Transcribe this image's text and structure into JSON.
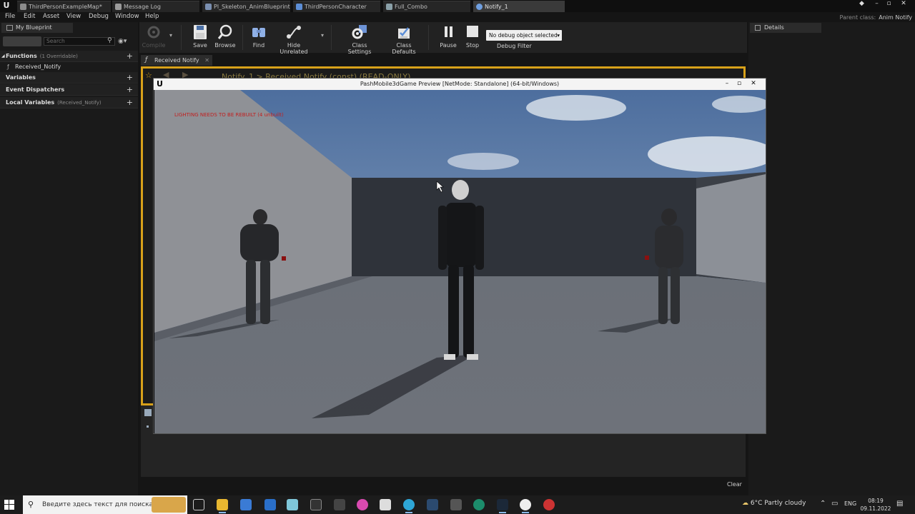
{
  "doc_tabs": [
    {
      "label": "ThirdPersonExampleMap*",
      "active": false
    },
    {
      "label": "Message Log",
      "active": false
    },
    {
      "label": "Pl_Skeleton_AnimBlueprint",
      "active": false
    },
    {
      "label": "ThirdPersonCharacter",
      "active": false
    },
    {
      "label": "Full_Combo",
      "active": false
    },
    {
      "label": "Notify_1",
      "active": true
    }
  ],
  "parent_class": {
    "label": "Parent class:",
    "value": "Anim Notify"
  },
  "menu": [
    "File",
    "Edit",
    "Asset",
    "View",
    "Debug",
    "Window",
    "Help"
  ],
  "my_blueprint": {
    "tab_label": "My Blueprint",
    "search_placeholder": "Search",
    "sections": {
      "functions": {
        "label": "Functions",
        "sub": "(1 Overridable)"
      },
      "variables": {
        "label": "Variables"
      },
      "event_dispatchers": {
        "label": "Event Dispatchers"
      },
      "local_variables": {
        "label": "Local Variables",
        "sub": "(Received_Notify)"
      }
    },
    "function_item": "Received_Notify"
  },
  "toolbar": {
    "compile": "Compile",
    "save": "Save",
    "browse": "Browse",
    "find": "Find",
    "hide_unrelated": "Hide Unrelated",
    "class_settings": "Class Settings",
    "class_defaults": "Class Defaults",
    "pause": "Pause",
    "stop": "Stop",
    "debug_select": "No debug object selected",
    "debug_filter": "Debug Filter"
  },
  "graph_tab": {
    "label": "Received Notify"
  },
  "graph_breadcrumb": "Notify_1  >  Received Notify (const)   (READ-ONLY)",
  "compiler": {
    "clear_label": "Clear"
  },
  "details": {
    "tab_label": "Details"
  },
  "preview": {
    "title": "PashMobile3dGame Preview [NetMode: Standalone] (64-bit/Windows)",
    "warning": "LIGHTING NEEDS TO BE REBUILT (4 unbuilt)"
  },
  "taskbar": {
    "search_placeholder": "Введите здесь текст для поиска",
    "weather": "6°C  Partly cloudy",
    "lang": "ENG",
    "time": "08:19",
    "date": "09.11.2022"
  }
}
